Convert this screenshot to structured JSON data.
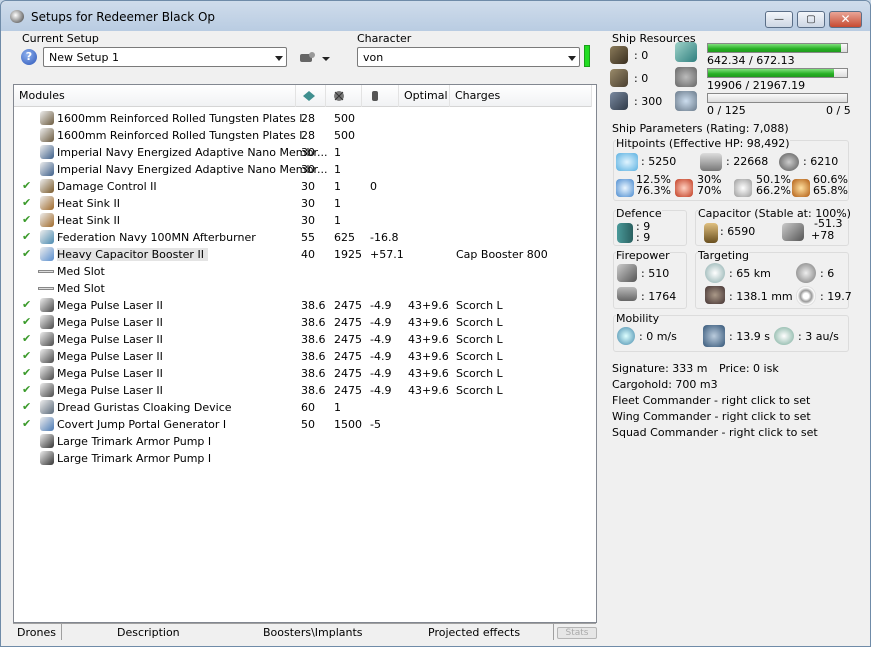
{
  "window": {
    "title": "Setups for Redeemer Black Op",
    "minimize": "—",
    "maximize": "▢",
    "close": "✕"
  },
  "setup": {
    "label": "Current Setup",
    "value": "New Setup 1"
  },
  "character": {
    "label": "Character",
    "value": "von"
  },
  "modules_table": {
    "headers": [
      "Modules",
      "",
      "",
      "",
      "Optimal",
      "Charges"
    ],
    "rows": [
      {
        "fitted": false,
        "name": "1600mm Reinforced Rolled Tungsten Plates I",
        "cpu": "28",
        "pg": "500",
        "cap": "",
        "optimal": "",
        "charges": "",
        "icon": "armor-plate-icon",
        "color": "#6b5a3e"
      },
      {
        "fitted": false,
        "name": "1600mm Reinforced Rolled Tungsten Plates I",
        "cpu": "28",
        "pg": "500",
        "cap": "",
        "optimal": "",
        "charges": "",
        "icon": "armor-plate-icon",
        "color": "#6b5a3e"
      },
      {
        "fitted": false,
        "name": "Imperial Navy Energized Adaptive Nano Membr...",
        "cpu": "30",
        "pg": "1",
        "cap": "",
        "optimal": "",
        "charges": "",
        "icon": "membrane-icon",
        "color": "#3d5f8a"
      },
      {
        "fitted": false,
        "name": "Imperial Navy Energized Adaptive Nano Membr...",
        "cpu": "30",
        "pg": "1",
        "cap": "",
        "optimal": "",
        "charges": "",
        "icon": "membrane-icon",
        "color": "#3d5f8a"
      },
      {
        "fitted": true,
        "name": "Damage Control II",
        "cpu": "30",
        "pg": "1",
        "cap": "0",
        "optimal": "",
        "charges": "",
        "icon": "damage-control-icon",
        "color": "#7a5a2a"
      },
      {
        "fitted": true,
        "name": "Heat Sink II",
        "cpu": "30",
        "pg": "1",
        "cap": "",
        "optimal": "",
        "charges": "",
        "icon": "heat-sink-icon",
        "color": "#a06a2a"
      },
      {
        "fitted": true,
        "name": "Heat Sink II",
        "cpu": "30",
        "pg": "1",
        "cap": "",
        "optimal": "",
        "charges": "",
        "icon": "heat-sink-icon",
        "color": "#a06a2a"
      },
      {
        "fitted": true,
        "name": "Federation Navy 100MN Afterburner",
        "cpu": "55",
        "pg": "625",
        "cap": "-16.8",
        "optimal": "",
        "charges": "",
        "icon": "afterburner-icon",
        "color": "#4a8ab0"
      },
      {
        "fitted": true,
        "name": "Heavy Capacitor Booster II",
        "cpu": "40",
        "pg": "1925",
        "cap": "+57.1",
        "optimal": "",
        "charges": "Cap Booster 800",
        "icon": "cap-booster-icon",
        "color": "#5a8fcf",
        "selected": true
      },
      {
        "fitted": false,
        "slot": true,
        "name": "Med Slot",
        "cpu": "",
        "pg": "",
        "cap": "",
        "optimal": "",
        "charges": ""
      },
      {
        "fitted": false,
        "slot": true,
        "name": "Med Slot",
        "cpu": "",
        "pg": "",
        "cap": "",
        "optimal": "",
        "charges": ""
      },
      {
        "fitted": true,
        "name": "Mega Pulse Laser II",
        "cpu": "38.6",
        "pg": "2475",
        "cap": "-4.9",
        "optimal": "43+9.6",
        "charges": "Scorch L",
        "icon": "laser-icon",
        "color": "#4a4a4a"
      },
      {
        "fitted": true,
        "name": "Mega Pulse Laser II",
        "cpu": "38.6",
        "pg": "2475",
        "cap": "-4.9",
        "optimal": "43+9.6",
        "charges": "Scorch L",
        "icon": "laser-icon",
        "color": "#4a4a4a"
      },
      {
        "fitted": true,
        "name": "Mega Pulse Laser II",
        "cpu": "38.6",
        "pg": "2475",
        "cap": "-4.9",
        "optimal": "43+9.6",
        "charges": "Scorch L",
        "icon": "laser-icon",
        "color": "#4a4a4a"
      },
      {
        "fitted": true,
        "name": "Mega Pulse Laser II",
        "cpu": "38.6",
        "pg": "2475",
        "cap": "-4.9",
        "optimal": "43+9.6",
        "charges": "Scorch L",
        "icon": "laser-icon",
        "color": "#4a4a4a"
      },
      {
        "fitted": true,
        "name": "Mega Pulse Laser II",
        "cpu": "38.6",
        "pg": "2475",
        "cap": "-4.9",
        "optimal": "43+9.6",
        "charges": "Scorch L",
        "icon": "laser-icon",
        "color": "#4a4a4a"
      },
      {
        "fitted": true,
        "name": "Mega Pulse Laser II",
        "cpu": "38.6",
        "pg": "2475",
        "cap": "-4.9",
        "optimal": "43+9.6",
        "charges": "Scorch L",
        "icon": "laser-icon",
        "color": "#4a4a4a"
      },
      {
        "fitted": true,
        "name": "Dread Guristas Cloaking Device",
        "cpu": "60",
        "pg": "1",
        "cap": "",
        "optimal": "",
        "charges": "",
        "icon": "cloak-icon",
        "color": "#5a6a7a"
      },
      {
        "fitted": true,
        "name": "Covert Jump Portal Generator I",
        "cpu": "50",
        "pg": "1500",
        "cap": "-5",
        "optimal": "",
        "charges": "",
        "icon": "portal-icon",
        "color": "#4a7ab5"
      },
      {
        "fitted": false,
        "name": "Large Trimark Armor Pump I",
        "cpu": "",
        "pg": "",
        "cap": "",
        "optimal": "",
        "charges": "",
        "icon": "rig-icon",
        "color": "#333333"
      },
      {
        "fitted": false,
        "name": "Large Trimark Armor Pump I",
        "cpu": "",
        "pg": "",
        "cap": "",
        "optimal": "",
        "charges": "",
        "icon": "rig-icon",
        "color": "#333333"
      }
    ]
  },
  "bottom_tabs": {
    "drones": "Drones",
    "description": "Description",
    "boosters": "Boosters\\Implants",
    "projected": "Projected effects",
    "stats": "Stats"
  },
  "resources": {
    "title": "Ship Resources",
    "turret": ": 0",
    "launcher": ": 0",
    "calibration": ": 300",
    "cpu": {
      "text": "642.34 / 672.13",
      "fraction": 0.956
    },
    "powergrid": {
      "text": "19906 / 21967.19",
      "fraction": 0.906
    },
    "drone_bay": {
      "text": "0 / 125",
      "fraction": 0.0
    },
    "drone_count": "0 / 5"
  },
  "parameters": {
    "title": "Ship Parameters (Rating: 7,088)",
    "hitpoints_title": "Hitpoints (Effective HP: 98,492)",
    "shield_hp": ": 5250",
    "armor_hp": ": 22668",
    "structure_hp": ": 6210",
    "resists": {
      "em": [
        "12.5%",
        "76.3%"
      ],
      "thermal": [
        "30%",
        "70%"
      ],
      "kinetic": [
        "50.1%",
        "66.2%"
      ],
      "explosive": [
        "60.6%",
        "65.8%"
      ]
    },
    "defence_title": "Defence",
    "defence_a": ": 9",
    "defence_b": ": 9",
    "capacitor_title": "Capacitor (Stable at: 100%)",
    "capacitor_amount": ": 6590",
    "capacitor_rate_a": "-51.3",
    "capacitor_rate_b": "+78",
    "firepower_title": "Firepower",
    "firepower_dps": ": 510",
    "firepower_volley": ": 1764",
    "targeting_title": "Targeting",
    "target_range": ": 65 km",
    "max_targets": ": 6",
    "scan_res": ": 138.1 mm",
    "sensor_strength": ": 19.7",
    "mobility_title": "Mobility",
    "speed": ": 0 m/s",
    "align_time": ": 13.9 s",
    "warp_speed": ": 3 au/s",
    "signature": "Signature: 333 m",
    "price": "Price: 0 isk",
    "cargohold": "Cargohold: 700 m3",
    "fleet_commander": "Fleet Commander - right click to set",
    "wing_commander": "Wing Commander - right click to set",
    "squad_commander": "Squad Commander - right click to set"
  },
  "colors": {
    "green": "#22dd22",
    "check": "#3a9a2a"
  }
}
